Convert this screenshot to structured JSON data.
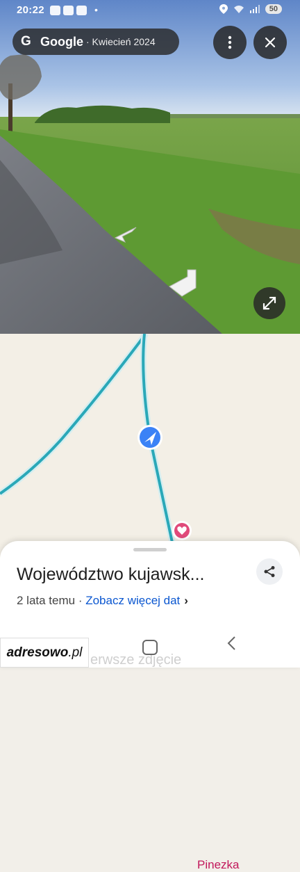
{
  "status_bar": {
    "time": "20:22",
    "dot": "•",
    "battery": "50"
  },
  "streetview": {
    "logo_letter": "G",
    "brand": "Google",
    "date": "· Kwiecień 2024",
    "menu_icon": "more-vert-icon",
    "close_icon": "close-icon",
    "expand_icon": "expand-icon"
  },
  "map": {
    "pin_label": "Pinezka",
    "location_marker": "navigation-arrow-icon"
  },
  "sheet": {
    "title": "Województwo kujawsk...",
    "age": "2 lata temu",
    "separator": " · ",
    "more_dates": "Zobacz więcej dat",
    "chevron": "›",
    "faded_text": "erwsze zdjęcie"
  },
  "watermark": {
    "brand_bold": "adresowo",
    "brand_suffix": ".pl"
  },
  "colors": {
    "road": "#2aa8b8",
    "pin": "#e04a7a",
    "accent": "#0b57d0",
    "location": "#3b82f6"
  }
}
